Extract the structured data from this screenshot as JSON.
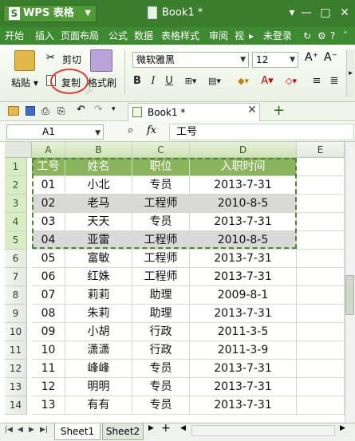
{
  "app": {
    "name": "WPS 表格",
    "doc_title": "Book1 *"
  },
  "menu": {
    "items": [
      "开始",
      "插入",
      "页面布局",
      "公式",
      "数据",
      "表格样式",
      "审阅",
      "视"
    ],
    "login": "未登录"
  },
  "ribbon": {
    "paste": "粘贴",
    "cut": "剪切",
    "copy": "复制",
    "format_painter": "格式刷",
    "font": "微软雅黑",
    "size": "12"
  },
  "tabs": {
    "book": "Book1 *"
  },
  "formula": {
    "cell_ref": "A1",
    "fx": "fx",
    "value": "工号"
  },
  "grid": {
    "columns": [
      "A",
      "B",
      "C",
      "D",
      "E"
    ],
    "rows": [
      [
        "工号",
        "姓名",
        "职位",
        "入职时间"
      ],
      [
        "01",
        "小北",
        "专员",
        "2013-7-31"
      ],
      [
        "02",
        "老马",
        "工程师",
        "2010-8-5"
      ],
      [
        "03",
        "天天",
        "专员",
        "2013-7-31"
      ],
      [
        "04",
        "亚雷",
        "工程师",
        "2010-8-5"
      ],
      [
        "05",
        "富敏",
        "工程师",
        "2013-7-31"
      ],
      [
        "06",
        "红姝",
        "工程师",
        "2013-7-31"
      ],
      [
        "07",
        "莉莉",
        "助理",
        "2009-8-1"
      ],
      [
        "08",
        "朱莉",
        "助理",
        "2013-7-31"
      ],
      [
        "09",
        "小胡",
        "行政",
        "2011-3-5"
      ],
      [
        "10",
        "潇潇",
        "行政",
        "2011-3-9"
      ],
      [
        "11",
        "峰峰",
        "专员",
        "2013-7-31"
      ],
      [
        "12",
        "明明",
        "专员",
        "2013-7-31"
      ],
      [
        "13",
        "有有",
        "专员",
        "2013-7-31"
      ]
    ]
  },
  "sheets": {
    "names": [
      "Sheet1",
      "Sheet2"
    ]
  },
  "colors": {
    "title_bg": "#3a7d2c",
    "header_fill": "#8ab55d",
    "band_fill": "#d9d9d9",
    "marquee": "#4a8a2f",
    "highlight_ring": "#e53935"
  }
}
